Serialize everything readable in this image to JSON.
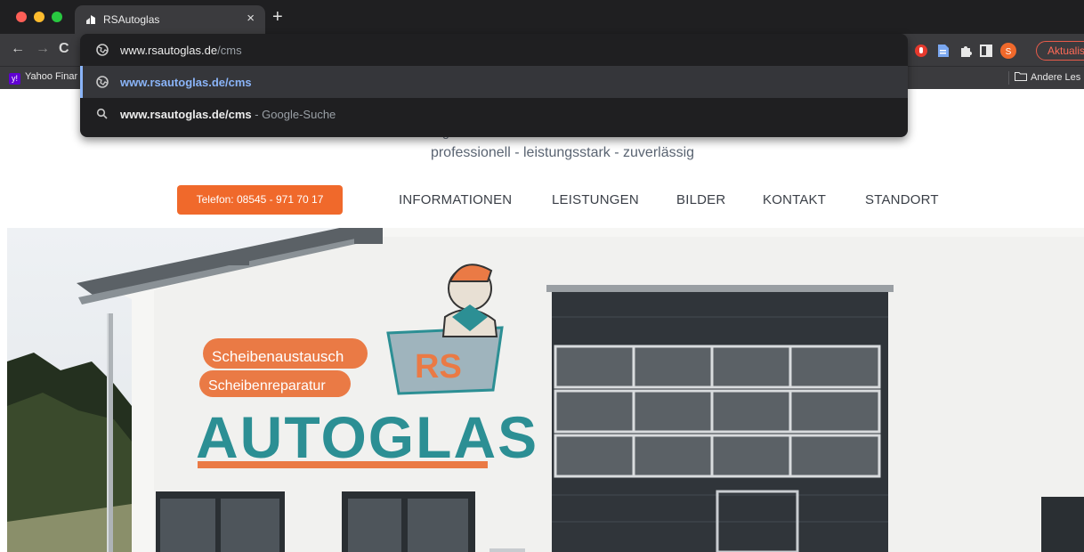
{
  "browser": {
    "tab_title": "RSAutoglas",
    "tab_close": "×",
    "new_tab": "+",
    "update_label": "Aktualis",
    "profile_initial": "S",
    "bookmarks": {
      "yahoo": "Yahoo Finar",
      "other": "Andere Les"
    }
  },
  "omnibox": {
    "input_domain": "www.rsautoglas.de",
    "input_path": "/cms",
    "suggestion_url": "www.rsautoglas.de/cms",
    "search_query": "www.rsautoglas.de/cms",
    "search_suffix": " - Google-Suche"
  },
  "page": {
    "tagline": "professionell - leistungsstark - zuverlässig",
    "phone_button": "Telefon: 08545 - 971 70 17",
    "nav": [
      "INFORMATIONEN",
      "LEISTUNGEN",
      "BILDER",
      "KONTAKT",
      "STANDORT"
    ]
  },
  "hero": {
    "signs": [
      "Scheibenaustausch",
      "Scheibenreparatur"
    ],
    "wordmark": "AUTOGLAS",
    "logo": "RS"
  },
  "colors": {
    "accent": "#f0692b",
    "teal": "#2c8f94",
    "link_blue": "#8ab4f8"
  },
  "icons": [
    "globe-icon",
    "search-icon",
    "extensions-icon",
    "puzzle-icon",
    "sidepanel-icon",
    "folder-icon"
  ]
}
